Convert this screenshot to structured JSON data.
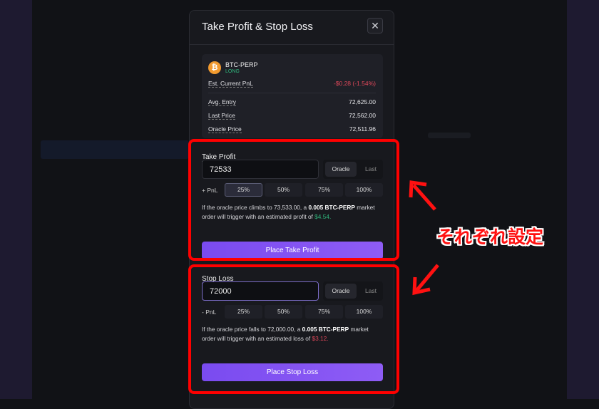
{
  "modal": {
    "title": "Take Profit & Stop Loss",
    "close_icon": "close-icon",
    "position": {
      "symbol": "BTC-PERP",
      "side": "LONG",
      "coin_icon": "bitcoin-icon",
      "pnl_label": "Est. Current PnL",
      "pnl_value": "-$0.28 (-1.54%)",
      "rows": [
        {
          "label": "Avg. Entry",
          "value": "72,625.00"
        },
        {
          "label": "Last Price",
          "value": "72,562.00"
        },
        {
          "label": "Oracle Price",
          "value": "72,511.96"
        }
      ]
    },
    "take_profit": {
      "label": "Take Profit",
      "value": "72533",
      "price_sources": [
        "Oracle",
        "Last"
      ],
      "selected_source": "Oracle",
      "pnl_label": "+ PnL",
      "pnl_options": [
        "25%",
        "50%",
        "75%",
        "100%"
      ],
      "selected_pnl": "25%",
      "desc_pre": "If the oracle price climbs to 73,533.00, a ",
      "desc_bold1": "0.005 BTC-PERP",
      "desc_mid": " market order will trigger with an estimated profit of ",
      "desc_amount": "$4.54",
      "button": "Place Take Profit"
    },
    "stop_loss": {
      "label": "Stop Loss",
      "value": "72000",
      "price_sources": [
        "Oracle",
        "Last"
      ],
      "selected_source": "Oracle",
      "pnl_label": "- PnL",
      "pnl_options": [
        "25%",
        "50%",
        "75%",
        "100%"
      ],
      "desc_pre": "If the oracle price falls to 72,000.00, a ",
      "desc_bold1": "0.005 BTC-PERP",
      "desc_mid": " market order will trigger with an estimated loss of ",
      "desc_amount": "$3.12",
      "button": "Place Stop Loss"
    }
  },
  "annotation": {
    "text": "それぞれ設定",
    "color": "#ff0000"
  },
  "colors": {
    "accent": "#7a4bf0",
    "profit": "#2fb67c",
    "loss": "#e0485a"
  }
}
